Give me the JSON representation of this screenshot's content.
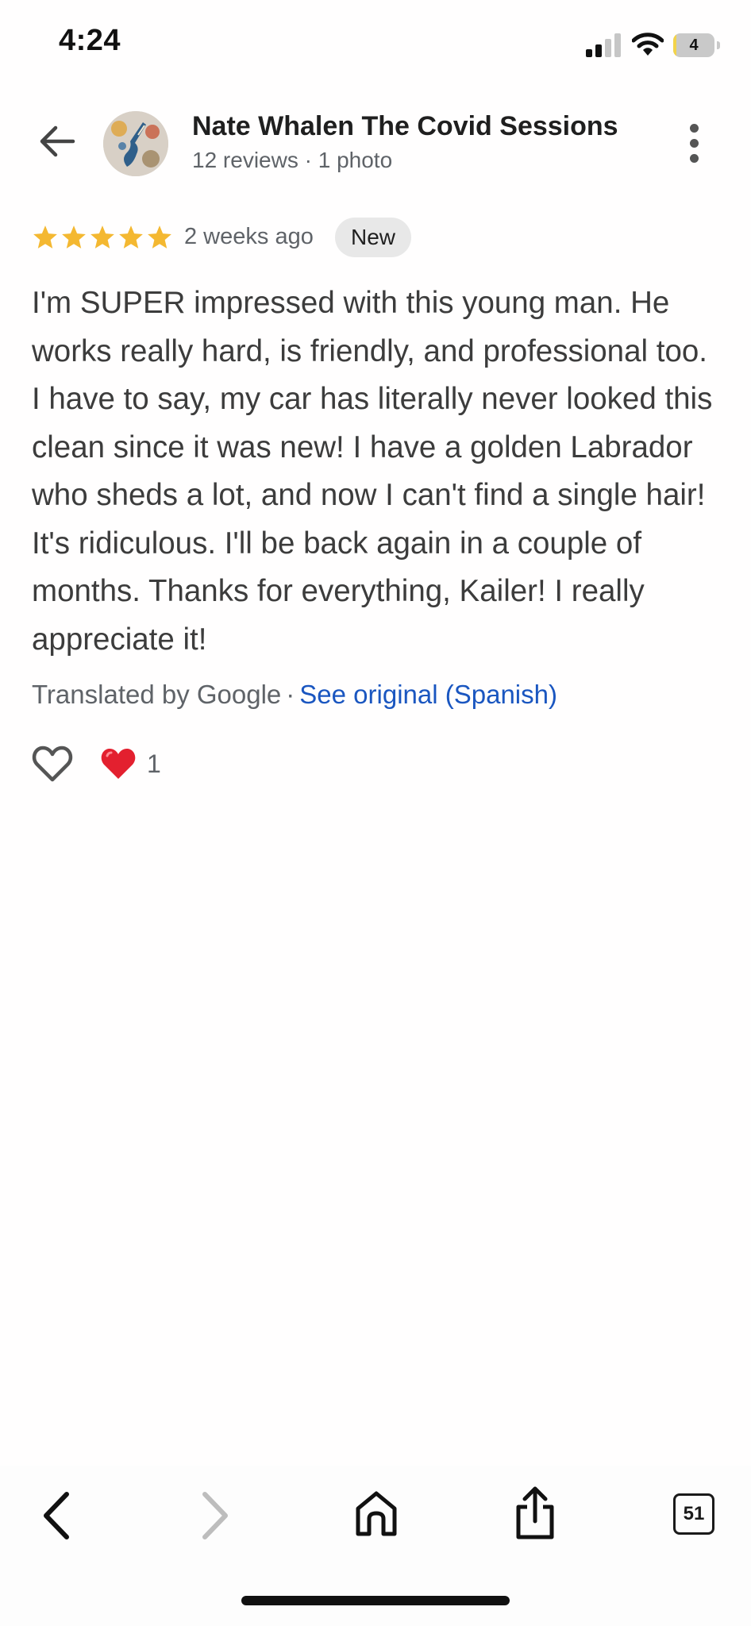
{
  "status_bar": {
    "time": "4:24",
    "battery_level": "4",
    "battery_fraction": 0.04
  },
  "header": {
    "back_icon": "arrow-left-icon",
    "reviewer_name": "Nate Whalen The Covid Sessions",
    "reviewer_meta": "12 reviews · 1 photo",
    "more_icon": "more-vertical-icon"
  },
  "review": {
    "rating": 5,
    "rating_max": 5,
    "star_color": "#F4B831",
    "time_ago": "2 weeks ago",
    "badge": "New",
    "text": "I'm SUPER impressed with this young man. He works really hard, is friendly, and professional too. I have to say, my car has literally never looked this clean since it was new! I have a golden Labrador who sheds a lot, and now I can't find a single hair! It's ridiculous. I'll be back again in a couple of months. Thanks for everything, Kailer! I really appreciate it!",
    "translated_by": "Translated by Google",
    "separator": "·",
    "see_original": "See original (Spanish)",
    "link_color": "#1A56C0",
    "reaction_count": "1"
  },
  "bottom_bar": {
    "tabs_count": "51"
  }
}
